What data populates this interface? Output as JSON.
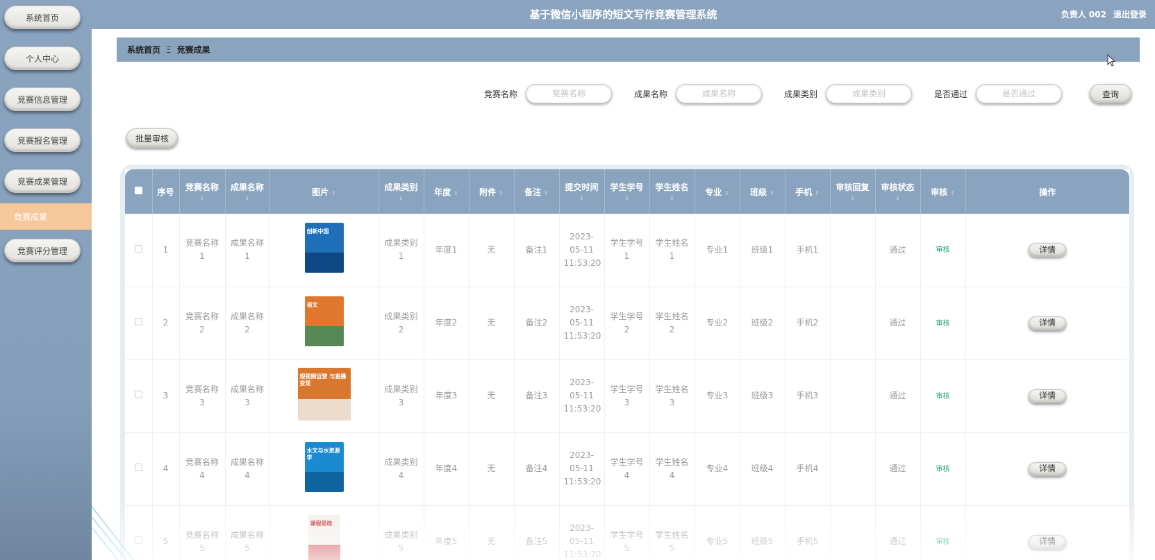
{
  "app": {
    "title": "基于微信小程序的短文写作竞赛管理系统",
    "user_label": "负责人 002",
    "logout_label": "退出登录"
  },
  "sidebar": {
    "items": [
      {
        "label": "系统首页"
      },
      {
        "label": "个人中心"
      },
      {
        "label": "竞赛信息管理"
      },
      {
        "label": "竞赛报名管理"
      },
      {
        "label": "竞赛成果管理"
      },
      {
        "label": "竞赛成果"
      },
      {
        "label": "竞赛评分管理"
      }
    ]
  },
  "breadcrumb": {
    "home": "系统首页",
    "separator": "Ξ",
    "current": "竞赛成果"
  },
  "search": {
    "fields": [
      {
        "label": "竞赛名称",
        "placeholder": "竞赛名称"
      },
      {
        "label": "成果名称",
        "placeholder": "成果名称"
      },
      {
        "label": "成果类别",
        "placeholder": "成果类别"
      },
      {
        "label": "是否通过",
        "placeholder": "是否通过"
      }
    ],
    "query_label": "查询"
  },
  "batch_label": "批量审核",
  "table": {
    "columns": [
      "序号",
      "竞赛名称",
      "成果名称",
      "图片",
      "成果类别",
      "年度",
      "附件",
      "备注",
      "提交时间",
      "学生学号",
      "学生姓名",
      "专业",
      "班级",
      "手机",
      "审核回复",
      "审核状态",
      "审核",
      "操作"
    ],
    "rows": [
      {
        "index": "1",
        "competition": "竞赛名称1",
        "achievement": "成果名称1",
        "category": "成果类别1",
        "year": "年度1",
        "attachment": "无",
        "note": "备注1",
        "time": "2023-05-11 11:53:20",
        "student_no": "学生学号1",
        "student_name": "学生姓名1",
        "major": "专业1",
        "class": "班级1",
        "phone": "手机1",
        "reply": "",
        "status": "通过",
        "audit": "审核",
        "action": "详情"
      },
      {
        "index": "2",
        "competition": "竞赛名称2",
        "achievement": "成果名称2",
        "category": "成果类别2",
        "year": "年度2",
        "attachment": "无",
        "note": "备注2",
        "time": "2023-05-11 11:53:20",
        "student_no": "学生学号2",
        "student_name": "学生姓名2",
        "major": "专业2",
        "class": "班级2",
        "phone": "手机2",
        "reply": "",
        "status": "通过",
        "audit": "审核",
        "action": "详情"
      },
      {
        "index": "3",
        "competition": "竞赛名称3",
        "achievement": "成果名称3",
        "category": "成果类别3",
        "year": "年度3",
        "attachment": "无",
        "note": "备注3",
        "time": "2023-05-11 11:53:20",
        "student_no": "学生学号3",
        "student_name": "学生姓名3",
        "major": "专业3",
        "class": "班级3",
        "phone": "手机3",
        "reply": "",
        "status": "通过",
        "audit": "审核",
        "action": "详情"
      },
      {
        "index": "4",
        "competition": "竞赛名称4",
        "achievement": "成果名称4",
        "category": "成果类别4",
        "year": "年度4",
        "attachment": "无",
        "note": "备注4",
        "time": "2023-05-11 11:53:20",
        "student_no": "学生学号4",
        "student_name": "学生姓名4",
        "major": "专业4",
        "class": "班级4",
        "phone": "手机4",
        "reply": "",
        "status": "通过",
        "audit": "审核",
        "action": "详情"
      },
      {
        "index": "5",
        "competition": "竞赛名称5",
        "achievement": "成果名称5",
        "category": "成果类别5",
        "year": "年度5",
        "attachment": "无",
        "note": "备注5",
        "time": "2023-05-11 11:53:20",
        "student_no": "学生学号5",
        "student_name": "学生姓名5",
        "major": "专业5",
        "class": "班级5",
        "phone": "手机5",
        "reply": "",
        "status": "通过",
        "audit": "审核",
        "action": "详情"
      }
    ],
    "book_covers": [
      {
        "title": "创新中国",
        "bg": "#1f6fb8",
        "accent": "#0d3f7a"
      },
      {
        "title": "语文",
        "bg": "#e0772e",
        "accent": "#3d8a5a"
      },
      {
        "title": "短视频运营 与直播变现",
        "bg": "#d9772f",
        "accent": "#f0ede6"
      },
      {
        "title": "水文与水资源学",
        "bg": "#1a8bd0",
        "accent": "#0e5c95"
      },
      {
        "title": "课程思政",
        "bg": "#f4f0ea",
        "accent": "#c8262b"
      }
    ]
  },
  "colors": {
    "primary": "#8aa4c0",
    "active": "#f5c79b",
    "audit_link": "#1e9e7a"
  }
}
